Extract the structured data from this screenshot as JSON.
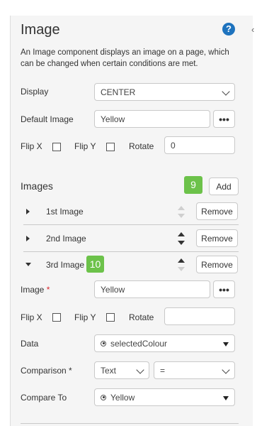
{
  "panel": {
    "title": "Image",
    "description": "An Image component displays an image on a page, which can be changed when certain conditions are met."
  },
  "display": {
    "label": "Display",
    "value": "CENTER"
  },
  "default_image": {
    "label": "Default Image",
    "value": "Yellow",
    "browse_label": "•••"
  },
  "flip_row": {
    "flip_x": "Flip X",
    "flip_y": "Flip Y",
    "rotate": "Rotate",
    "rotate_value": "0"
  },
  "images": {
    "heading": "Images",
    "badge_add": "9",
    "add_label": "Add",
    "items": [
      {
        "label": "1st Image",
        "remove_label": "Remove"
      },
      {
        "label": "2nd Image",
        "remove_label": "Remove"
      },
      {
        "label": "3rd Image",
        "remove_label": "Remove",
        "badge": "10"
      }
    ]
  },
  "expanded": {
    "image_label": "Image",
    "required_mark": "*",
    "image_value": "Yellow",
    "browse_label": "•••",
    "flip_x": "Flip X",
    "flip_y": "Flip Y",
    "rotate": "Rotate",
    "rotate_value": "",
    "data_label": "Data",
    "data_value": "selectedColour",
    "comparison_label": "Comparison *",
    "comparison_type": "Text",
    "comparison_op": "=",
    "compare_to_label": "Compare To",
    "compare_to_value": "Yellow"
  },
  "colors": {
    "badge": "#6cc24a",
    "help": "#1e73be",
    "required": "#d9262c"
  }
}
